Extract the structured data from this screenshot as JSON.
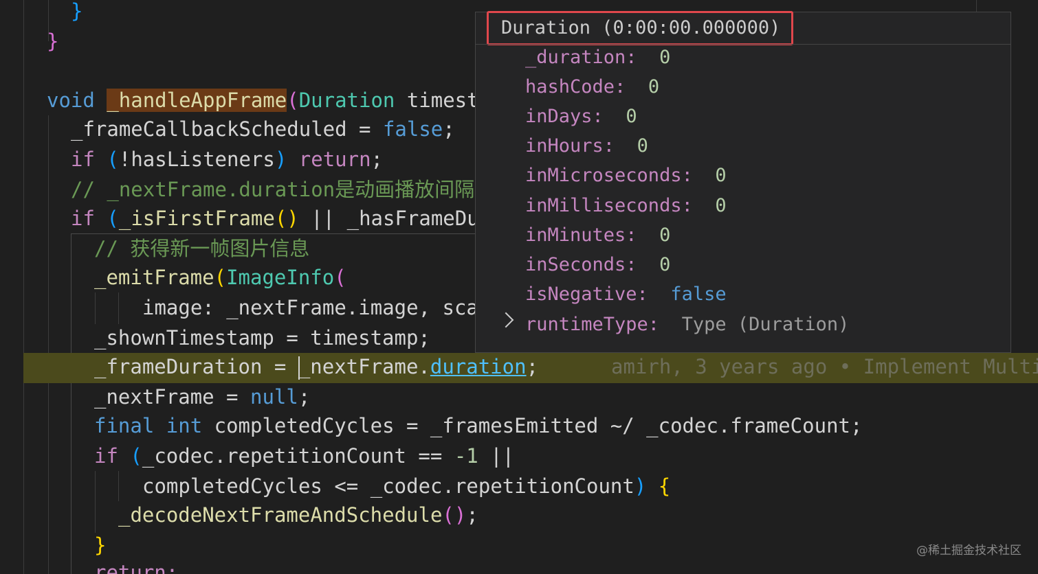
{
  "code": {
    "l1_brace": "}",
    "l2_brace": "}",
    "l3_void": "void",
    "l3_fn": "_handleAppFrame",
    "l3_paren": "(",
    "l3_type": "Duration",
    "l3_param": " timest",
    "l4_a": "_frameCallbackScheduled = ",
    "l4_false": "false",
    "l4_semi": ";",
    "l5_if": "if",
    "l5_paren_open": "(",
    "l5_cond": "!hasListeners",
    "l5_paren_close": ")",
    "l5_return": "return",
    "l5_semi": ";",
    "l6_comment": "// _nextFrame.duration是动画播放间隔,",
    "l7_if": "if",
    "l7_paren": "(",
    "l7_call": "_isFirstFrame",
    "l7_call_parens": "()",
    "l7_rest": " || _hasFrameDu",
    "l8_comment": "// 获得新一帧图片信息",
    "l9_fn": "_emitFrame",
    "l9_paren": "(",
    "l9_type": "ImageInfo",
    "l9_paren2": "(",
    "l10_text": "image: _nextFrame.image, sca",
    "l11_text": "_shownTimestamp = timestamp;",
    "l12_a": "_frameDuration = ",
    "l12_b": "_nextFrame.",
    "l12_link": "duration",
    "l12_semi": ";",
    "l12_blame": "amirh, 3 years ago • Implement Multi",
    "l13_a": "_nextFrame = ",
    "l13_null": "null",
    "l13_semi": ";",
    "l14_final": "final",
    "l14_int": "int",
    "l14_rest": " completedCycles = _framesEmitted ~/ _codec.frameCount;",
    "l15_if": "if",
    "l15_paren": "(",
    "l15_a": "_codec.repetitionCount == ",
    "l15_num": "-1",
    "l15_rest": " ||",
    "l16_a": "completedCycles <= _codec.repetitionCount",
    "l16_paren": ")",
    "l16_brace": "{",
    "l17_fn": "_decodeNextFrameAndSchedule",
    "l17_parens": "()",
    "l17_semi": ";",
    "l18_brace": "}",
    "l19_return": "return;"
  },
  "hover": {
    "title": "Duration (0:00:00.000000)",
    "props": [
      {
        "key": "_duration:",
        "value": "0"
      },
      {
        "key": "hashCode:",
        "value": "0"
      },
      {
        "key": "inDays:",
        "value": "0"
      },
      {
        "key": "inHours:",
        "value": "0"
      },
      {
        "key": "inMicroseconds:",
        "value": "0"
      },
      {
        "key": "inMilliseconds:",
        "value": "0"
      },
      {
        "key": "inMinutes:",
        "value": "0"
      },
      {
        "key": "inSeconds:",
        "value": "0"
      },
      {
        "key": "isNegative:",
        "value": "false"
      },
      {
        "key": "runtimeType:",
        "value": "Type (Duration)"
      }
    ]
  },
  "watermark": "@稀土掘金技术社区"
}
